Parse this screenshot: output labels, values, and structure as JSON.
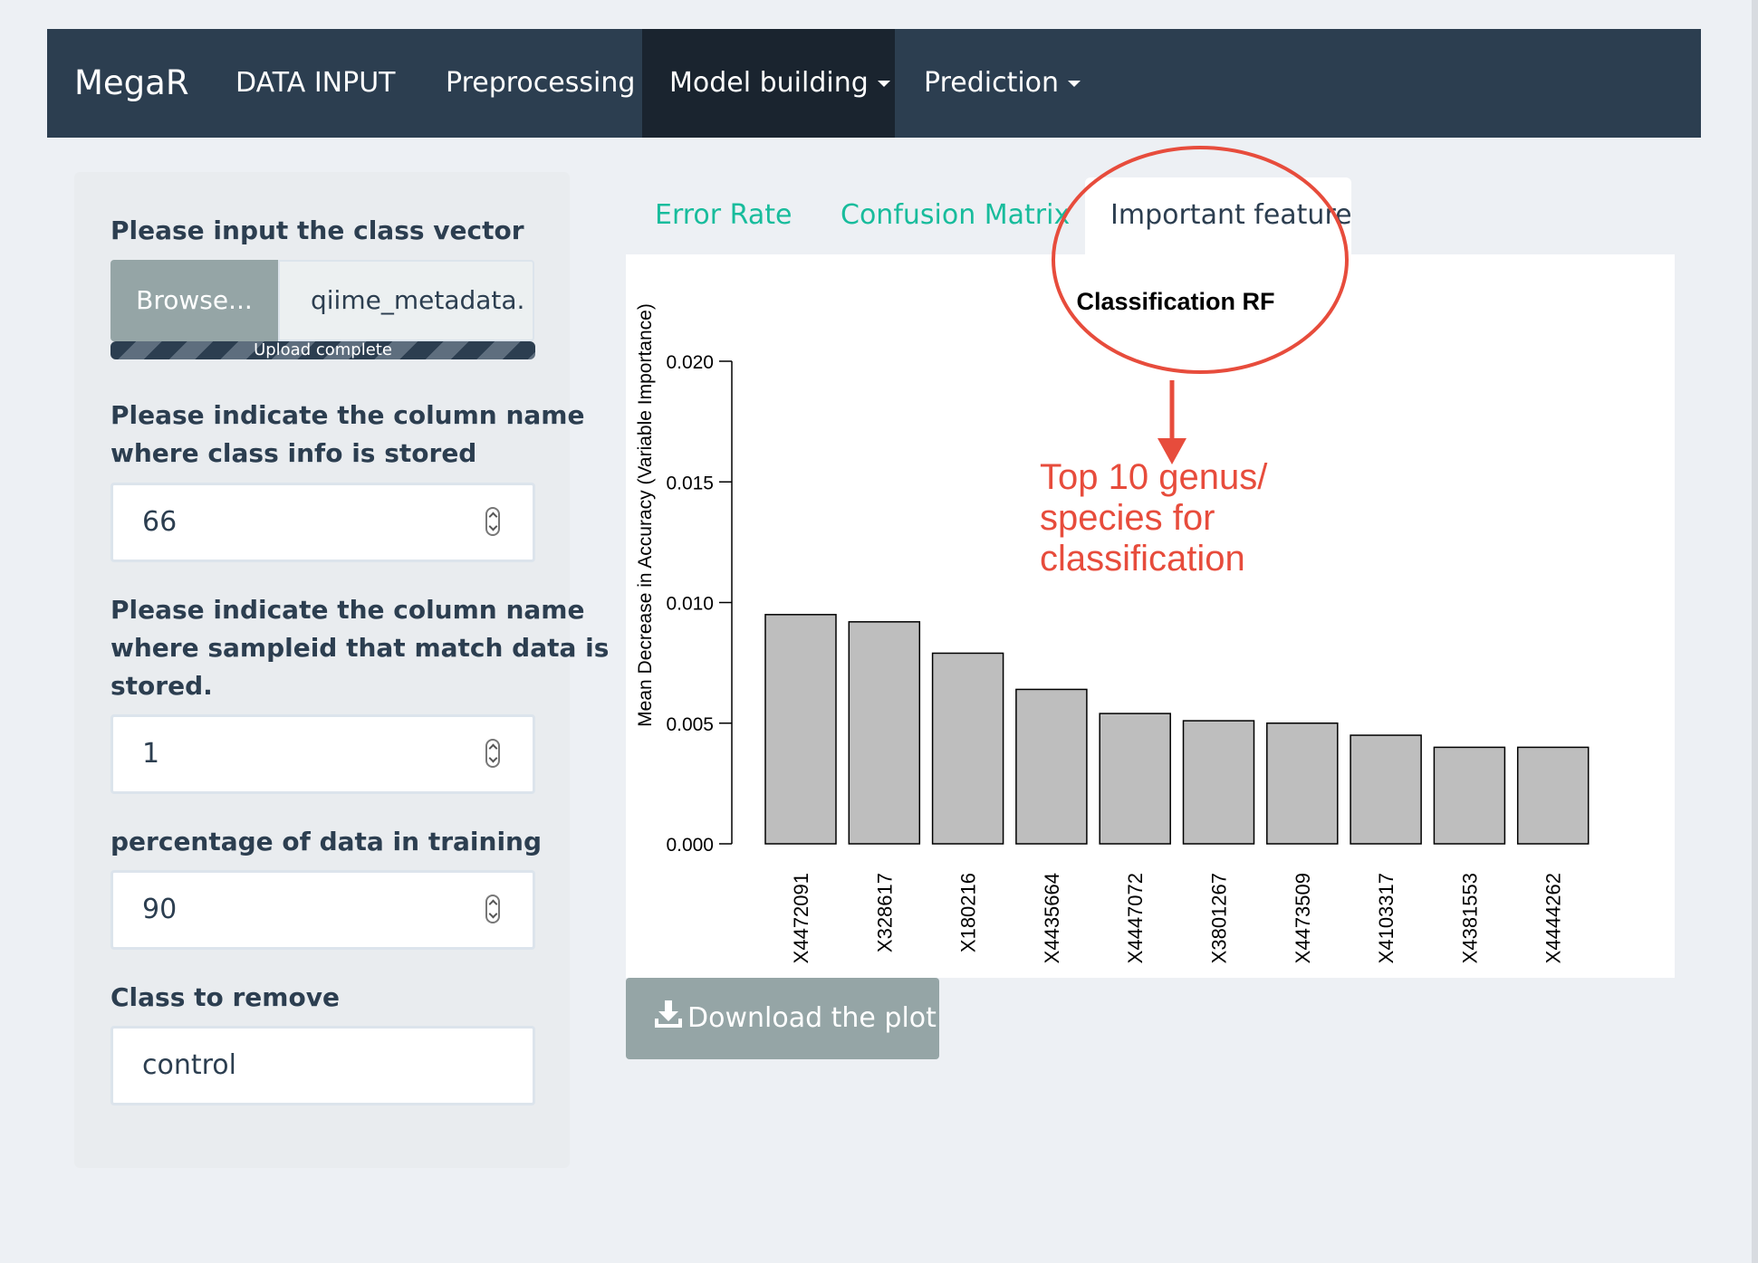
{
  "navbar": {
    "brand": "MegaR",
    "items": [
      {
        "label": "DATA INPUT",
        "active": false,
        "dropdown": false
      },
      {
        "label": "Preprocessing",
        "active": false,
        "dropdown": false
      },
      {
        "label": "Model building",
        "active": true,
        "dropdown": true
      },
      {
        "label": "Prediction",
        "active": false,
        "dropdown": true
      }
    ]
  },
  "sidebar": {
    "class_vector": {
      "label": "Please input the class vector",
      "browse_label": "Browse...",
      "file_name": "qiime_metadata.",
      "upload_status": "Upload complete",
      "upload_progress": 1.0
    },
    "class_column": {
      "label_line1": "Please indicate the column name",
      "label_line2": "where class info is stored",
      "value": "66"
    },
    "sampleid_column": {
      "label_line1": "Please indicate the column name",
      "label_line2": "where sampleid that match data is",
      "label_line3": "stored.",
      "value": "1"
    },
    "training_pct": {
      "label": "percentage of data in training",
      "value": "90"
    },
    "class_remove": {
      "label": "Class to remove",
      "value": "control"
    }
  },
  "tabs": [
    {
      "label": "Error Rate",
      "active": false
    },
    {
      "label": "Confusion Matrix",
      "active": false
    },
    {
      "label": "Important feature",
      "active": true
    }
  ],
  "download_label": "Download the plot",
  "annotation": {
    "line1": "Top 10 genus/",
    "line2": "species for",
    "line3": "classification"
  },
  "colors": {
    "navbar": "#2c3e50",
    "navbar_active": "#1a242f",
    "tab_link": "#18bc9c",
    "annotation": "#e74c3c",
    "bar_fill": "#bebebe",
    "button": "#95a5a6"
  },
  "chart_data": {
    "type": "bar",
    "title": "Classification RF",
    "ylabel": "Mean Decrease in Accuracy (Variable Importance)",
    "xlabel": "",
    "categories": [
      "X4472091",
      "X328617",
      "X180216",
      "X4435664",
      "X4447072",
      "X3801267",
      "X4473509",
      "X4103317",
      "X4381553",
      "X4444262"
    ],
    "values": [
      0.0095,
      0.0092,
      0.0079,
      0.0064,
      0.0054,
      0.0051,
      0.005,
      0.0045,
      0.004,
      0.004
    ],
    "ylim": [
      0,
      0.02
    ],
    "yticks": [
      "0.000",
      "0.005",
      "0.010",
      "0.015",
      "0.020"
    ],
    "grid": false,
    "legend": "none"
  }
}
